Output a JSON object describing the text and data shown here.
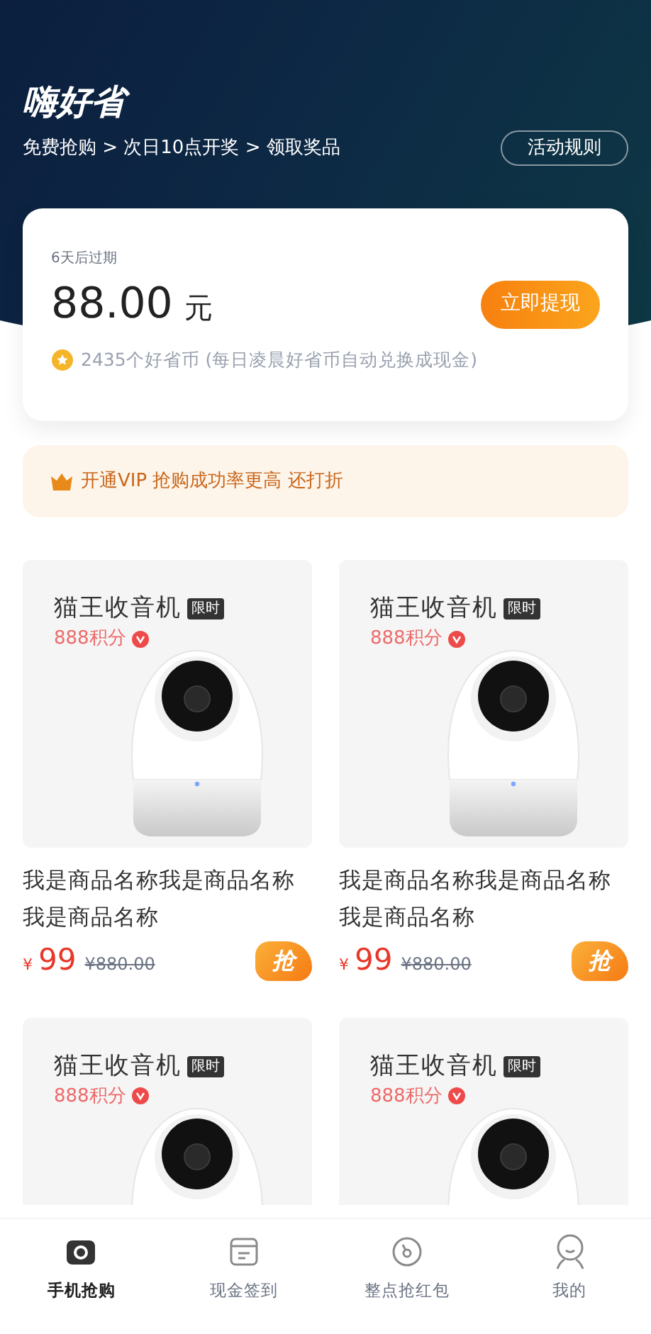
{
  "header": {
    "title": "嗨好省",
    "steps": "免费抢购 > 次日10点开奖 > 领取奖品",
    "rules_button": "活动规则"
  },
  "wallet": {
    "expiry": "6天后过期",
    "amount": "88.00",
    "unit": "元",
    "withdraw_button": "立即提现",
    "coins": "2435个好省币 (每日凌晨好省币自动兑换成现金)"
  },
  "vip_banner": {
    "text": "开通VIP 抢购成功率更高 还打折"
  },
  "products": [
    {
      "title": "猫王收音机",
      "tag": "限时",
      "points": "888积分",
      "name": "我是商品名称我是商品名称我是商品名称",
      "price_symbol": "¥",
      "price": "99",
      "original_price": "¥880.00",
      "grab_button": "抢"
    },
    {
      "title": "猫王收音机",
      "tag": "限时",
      "points": "888积分",
      "name": "我是商品名称我是商品名称我是商品名称",
      "price_symbol": "¥",
      "price": "99",
      "original_price": "¥880.00",
      "grab_button": "抢"
    },
    {
      "title": "猫王收音机",
      "tag": "限时",
      "points": "888积分"
    },
    {
      "title": "猫王收音机",
      "tag": "限时",
      "points": "888积分"
    }
  ],
  "tab_bar": [
    {
      "kind": "camera",
      "label": "手机抢购",
      "selected": true
    },
    {
      "kind": "calendar",
      "label": "现金签到",
      "selected": false
    },
    {
      "kind": "dial",
      "label": "整点抢红包",
      "selected": false
    },
    {
      "kind": "person",
      "label": "我的",
      "selected": false
    }
  ]
}
